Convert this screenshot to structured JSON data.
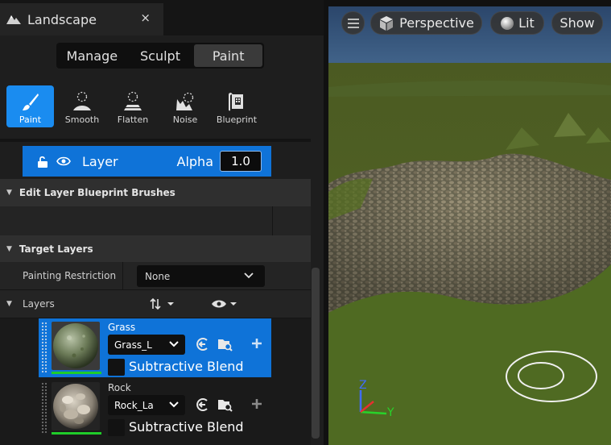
{
  "tab": {
    "title": "Landscape",
    "close": "×"
  },
  "modes": [
    "Manage",
    "Sculpt",
    "Paint"
  ],
  "tools": [
    {
      "label": "Paint",
      "icon": "paint-brush-icon"
    },
    {
      "label": "Smooth",
      "icon": "smooth-icon"
    },
    {
      "label": "Flatten",
      "icon": "flatten-icon"
    },
    {
      "label": "Noise",
      "icon": "noise-icon"
    },
    {
      "label": "Blueprint",
      "icon": "blueprint-icon"
    }
  ],
  "layer_row": {
    "label": "Layer",
    "alpha_label": "Alpha",
    "alpha_value": "1.0"
  },
  "sections": {
    "blueprint_brushes": "Edit Layer Blueprint Brushes",
    "target_layers": "Target Layers"
  },
  "painting_restriction": {
    "label": "Painting Restriction",
    "value": "None"
  },
  "layers_label": "Layers",
  "layers": [
    {
      "name": "Grass",
      "material": "Grass_L",
      "subtractive": "Subtractive Blend",
      "selected": true
    },
    {
      "name": "Rock",
      "material": "Rock_La",
      "subtractive": "Subtractive Blend",
      "selected": false
    }
  ],
  "viewport": {
    "menu_icon": "hamburger-icon",
    "perspective": "Perspective",
    "lit": "Lit",
    "show": "Show",
    "axis_z": "Z",
    "axis_y": "Y"
  },
  "colors": {
    "accent": "#0f73d8",
    "tool_active": "#1a8cf0",
    "green": "#1fcc2a"
  }
}
